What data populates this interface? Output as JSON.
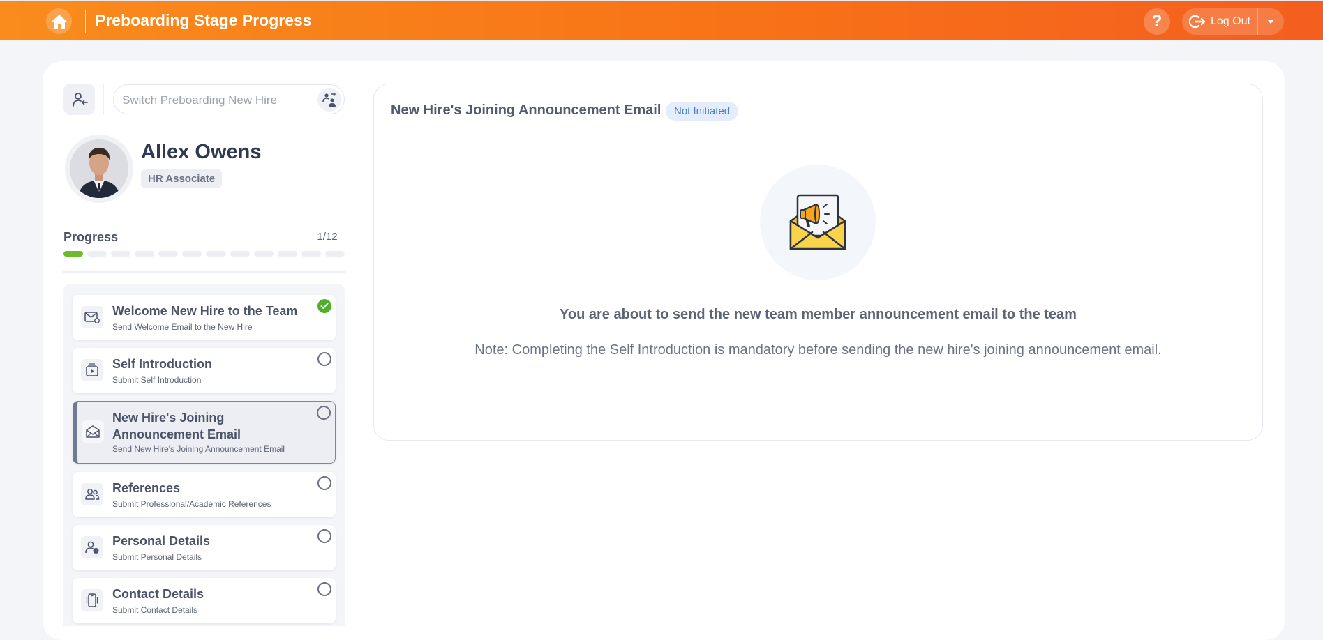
{
  "header": {
    "title": "Preboarding Stage Progress",
    "help_label": "?",
    "logout_label": "Log Out",
    "gradient_start": "#f98c1d",
    "gradient_end": "#f45e1f"
  },
  "sidebar": {
    "search": {
      "placeholder": "Switch Preboarding New Hire",
      "value": ""
    },
    "profile": {
      "name": "Allex Owens",
      "role": "HR Associate"
    },
    "progress": {
      "label": "Progress",
      "count": "1/12",
      "completed": 1,
      "total": 12,
      "accent": "#6dbb2a"
    },
    "steps": [
      {
        "title": "Welcome New Hire to the Team",
        "subtitle": "Send Welcome Email to the New Hire",
        "status": "completed",
        "icon": "mail-icon"
      },
      {
        "title": "Self Introduction",
        "subtitle": "Submit Self Introduction",
        "status": "pending",
        "icon": "video-icon"
      },
      {
        "title": "New Hire's Joining Announcement Email",
        "subtitle": "Send New Hire's Joining Announcement Email",
        "status": "pending",
        "active": true,
        "icon": "envelope-icon"
      },
      {
        "title": "References",
        "subtitle": "Submit Professional/Academic References",
        "status": "pending",
        "icon": "users-icon"
      },
      {
        "title": "Personal Details",
        "subtitle": "Submit Personal Details",
        "status": "pending",
        "icon": "user-info-icon"
      },
      {
        "title": "Contact Details",
        "subtitle": "Submit Contact Details",
        "status": "pending",
        "icon": "phone-icon"
      }
    ]
  },
  "content": {
    "title": "New Hire's Joining Announcement Email",
    "status": "Not Initiated",
    "heading": "You are about to send the new team member announcement email to the team",
    "note": "Note: Completing the Self Introduction is mandatory before sending the new hire's joining announcement email.",
    "illustration": "announcement-envelope-icon"
  }
}
